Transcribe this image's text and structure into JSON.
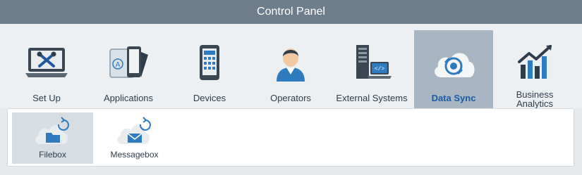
{
  "window": {
    "title": "Control Panel"
  },
  "toolbar": {
    "items": [
      {
        "label": "Set Up",
        "icon": "laptop-tools-icon"
      },
      {
        "label": "Applications",
        "icon": "tablet-phone-icon"
      },
      {
        "label": "Devices",
        "icon": "mobile-device-icon"
      },
      {
        "label": "Operators",
        "icon": "operator-icon"
      },
      {
        "label": "External Systems",
        "icon": "server-laptop-icon"
      },
      {
        "label": "Data Sync",
        "icon": "cloud-sync-icon",
        "active": true
      },
      {
        "label": "Business\nAnalytics",
        "icon": "bar-chart-trend-icon"
      }
    ]
  },
  "subpanel": {
    "items": [
      {
        "label": "Filebox",
        "icon": "cloud-folder-sync-icon",
        "active": true
      },
      {
        "label": "Messagebox",
        "icon": "cloud-envelope-sync-icon"
      }
    ]
  },
  "colors": {
    "titlebar": "#6d7d8b",
    "active_tab": "#a7b6c2",
    "active_label": "#1f5aa0",
    "accent_blue": "#2f7bbf"
  }
}
